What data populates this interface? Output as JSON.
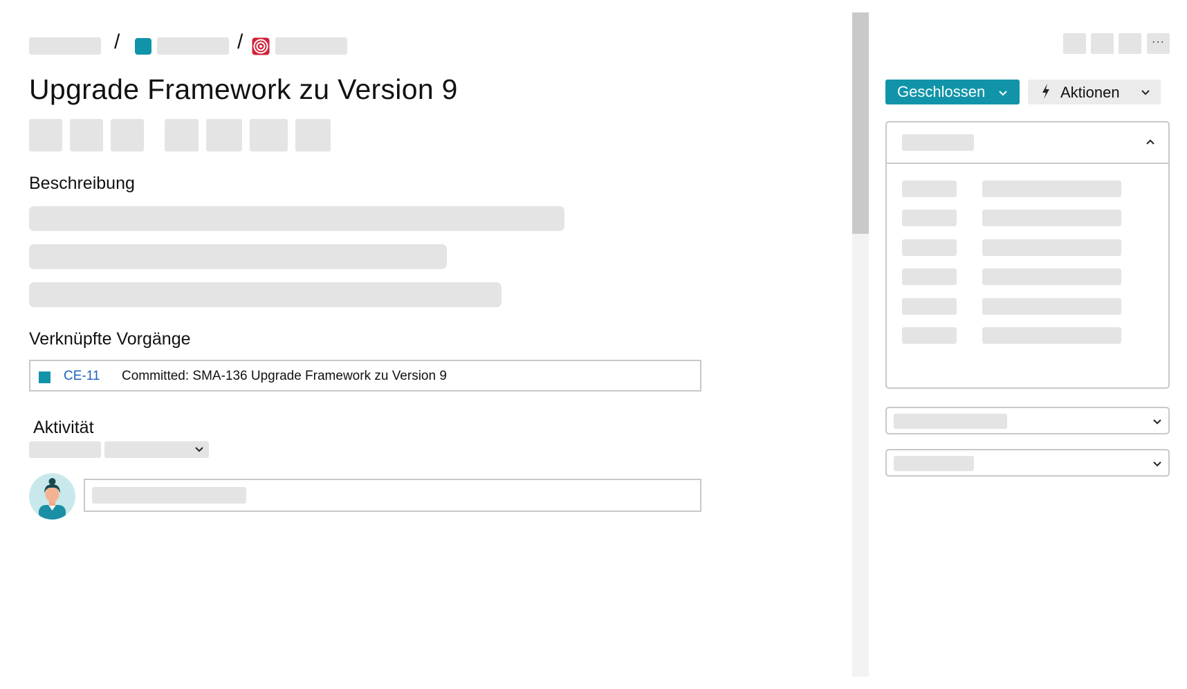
{
  "breadcrumb": {
    "separator": "/",
    "project_icon_color": "#1194a9",
    "issue_type_icon": "target-icon"
  },
  "issue": {
    "title": "Upgrade Framework zu Version 9"
  },
  "sections": {
    "description_heading": "Beschreibung",
    "linked_heading": "Verknüpfte Vorgänge",
    "activity_heading": "Aktivität"
  },
  "linked_issues": [
    {
      "key": "CE-11",
      "summary": "Committed: SMA-136 Upgrade Framework zu Version 9",
      "type_color": "#1194a9"
    }
  ],
  "toolbar": {
    "more_label": "···"
  },
  "status": {
    "label": "Geschlossen",
    "color": "#1194a9"
  },
  "actions": {
    "label": "Aktionen"
  },
  "colors": {
    "accent": "#1194a9",
    "link": "#1a62c0",
    "placeholder": "#e4e4e4",
    "border": "#c8c8c8"
  }
}
